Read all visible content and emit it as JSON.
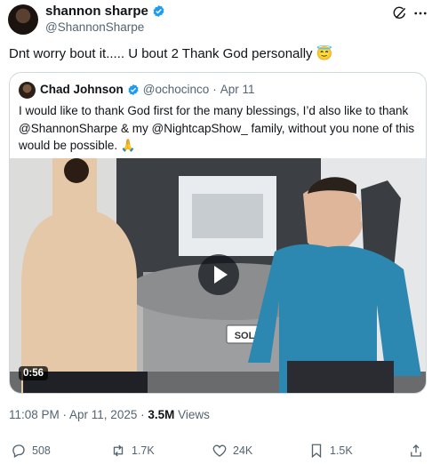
{
  "author": {
    "name": "shannon sharpe",
    "handle": "@ShannonSharpe"
  },
  "tweet": {
    "text": "Dnt worry bout it..... U bout 2 Thank God personally",
    "emoji": "😇"
  },
  "quote": {
    "name": "Chad Johnson",
    "handle": "@ochocinco",
    "separator": "·",
    "date": "Apr 11",
    "text": "I would like to thank God first for the many blessings, I’d also like to thank\n@ShannonSharpe & my @NightcapShow_ family, without you none of this\nwould be possible.",
    "emoji": "🙏",
    "video": {
      "duration": "0:56",
      "sign_text": "SOLD"
    }
  },
  "meta": {
    "time": "11:08 PM · Apr 11, 2025 · ",
    "views_count": "3.5M",
    "views_label": " Views"
  },
  "actions": {
    "replies": "508",
    "reposts": "1.7K",
    "likes": "24K",
    "bookmarks": "1.5K"
  },
  "icons": [
    "verified-badge-icon",
    "grok-icon",
    "more-icon",
    "reply-icon",
    "repost-icon",
    "like-icon",
    "bookmark-icon",
    "share-icon",
    "play-icon"
  ],
  "colors": {
    "verified": "#1d9bf0",
    "secondary_text": "#536471",
    "border": "#cfd9de"
  }
}
